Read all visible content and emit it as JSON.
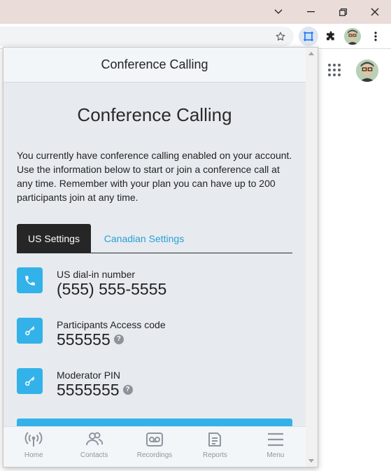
{
  "colors": {
    "accent": "#33b2ea",
    "link": "#2a9fd6",
    "tab_active_bg": "#262626",
    "panel_bg": "#e7ebef"
  },
  "window_controls": [
    "chevron-down-icon",
    "minimize-icon",
    "restore-icon",
    "close-icon"
  ],
  "toolbar_icons": [
    "star-icon",
    "extension-screen-icon",
    "puzzle-icon",
    "profile-avatar",
    "more-icon"
  ],
  "popup": {
    "header_title": "Conference Calling",
    "title": "Conference Calling",
    "description": "You currently have conference calling enabled on your account. Use the information below to start or join a conference call at any time. Remember with your plan you can have up to 200 participants join at any time.",
    "tabs": [
      {
        "label": "US Settings",
        "active": true
      },
      {
        "label": "Canadian Settings",
        "active": false
      }
    ],
    "items": [
      {
        "label": "US dial-in number",
        "value": "(555) 555-5555",
        "icon": "phone-icon",
        "help": false
      },
      {
        "label": "Participants Access code",
        "value": "555555",
        "icon": "key-icon",
        "help": true
      },
      {
        "label": "Moderator PIN",
        "value": "5555555",
        "icon": "key-icon",
        "help": true
      }
    ],
    "help_glyph": "?",
    "bottom_nav": [
      {
        "label": "Home",
        "icon": "broadcast-icon"
      },
      {
        "label": "Contacts",
        "icon": "contacts-icon"
      },
      {
        "label": "Recordings",
        "icon": "voicemail-icon"
      },
      {
        "label": "Reports",
        "icon": "report-icon"
      },
      {
        "label": "Menu",
        "icon": "menu-icon"
      }
    ]
  }
}
